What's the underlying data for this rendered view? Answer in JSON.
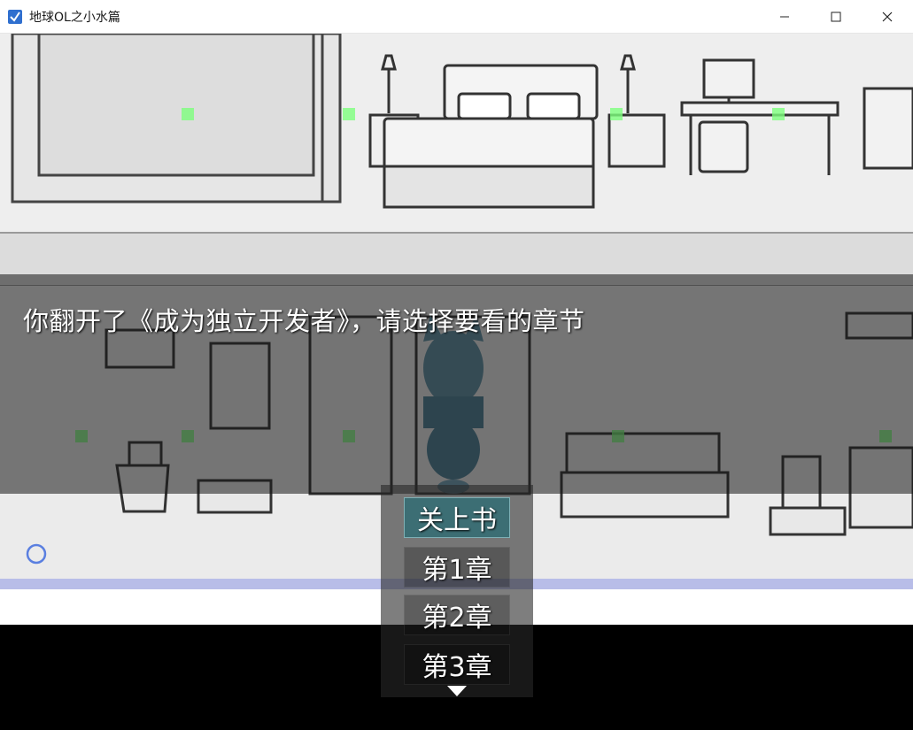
{
  "window": {
    "title": "地球OL之小水篇",
    "controls": [
      "minimize",
      "maximize",
      "close"
    ]
  },
  "message": {
    "text": "你翻开了《成为独立开发者》，请选择要看的章节"
  },
  "choices": {
    "items": [
      "关上书",
      "第1章",
      "第2章",
      "第3章"
    ],
    "selected_index": 0,
    "more_indicator": "chevron-down-icon"
  },
  "colors": {
    "selected_choice": "#3c6e74",
    "message_bg": "#141414",
    "event_marker": "#7dff7d"
  }
}
